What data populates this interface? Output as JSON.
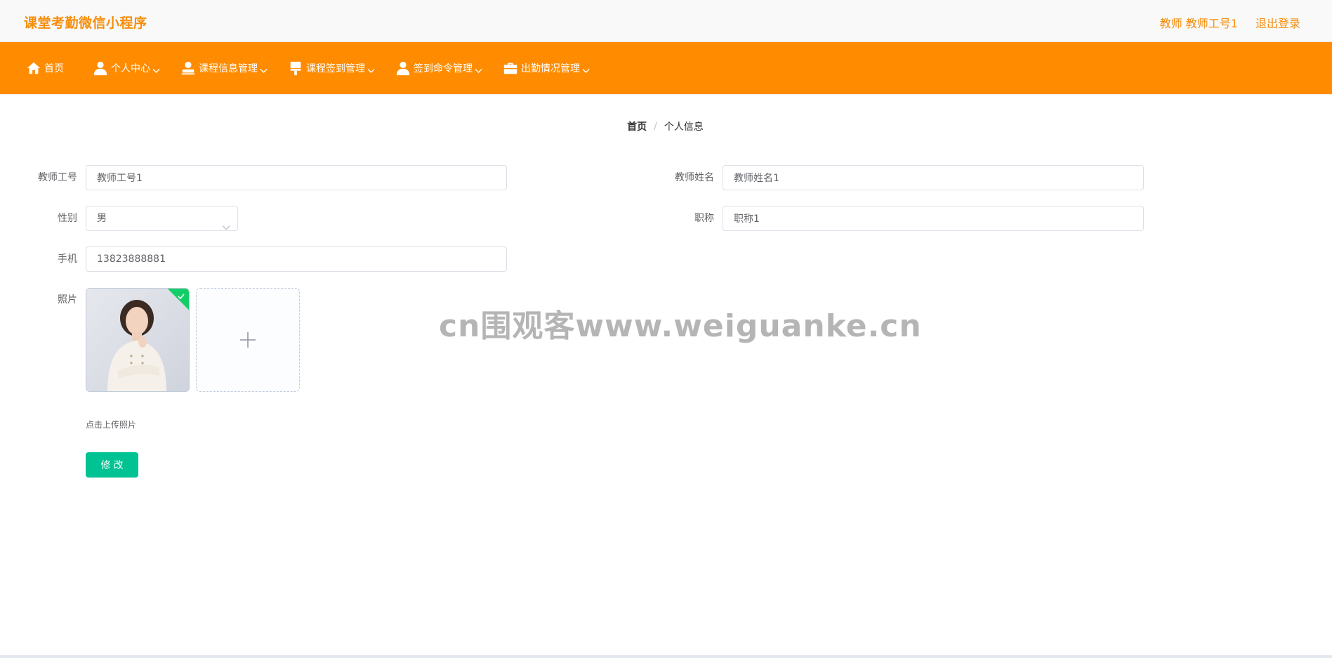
{
  "header": {
    "title": "课堂考勤微信小程序",
    "user_label": "教师 教师工号1",
    "logout_label": "退出登录"
  },
  "nav": {
    "items": [
      {
        "label": "首页",
        "icon": "home-icon",
        "has_dropdown": false
      },
      {
        "label": "个人中心",
        "icon": "user-icon",
        "has_dropdown": true
      },
      {
        "label": "课程信息管理",
        "icon": "stamp-icon",
        "has_dropdown": true
      },
      {
        "label": "课程签到管理",
        "icon": "brush-icon",
        "has_dropdown": true
      },
      {
        "label": "签到命令管理",
        "icon": "user-icon",
        "has_dropdown": true
      },
      {
        "label": "出勤情况管理",
        "icon": "briefcase-icon",
        "has_dropdown": true
      }
    ]
  },
  "breadcrumb": {
    "home": "首页",
    "separator": "/",
    "current": "个人信息"
  },
  "form": {
    "teacher_id": {
      "label": "教师工号",
      "value": "教师工号1"
    },
    "teacher_name": {
      "label": "教师姓名",
      "value": "教师姓名1"
    },
    "gender": {
      "label": "性别",
      "value": "男"
    },
    "title": {
      "label": "职称",
      "value": "职称1"
    },
    "phone": {
      "label": "手机",
      "value": "13823888881"
    },
    "photo": {
      "label": "照片",
      "tip": "点击上传照片"
    },
    "submit_label": "修改"
  },
  "watermark": "cn围观客www.weiguanke.cn",
  "colors": {
    "brand": "#f58d0b",
    "nav_bg": "#ff8c00",
    "submit_bg": "#00c292",
    "upload_success": "#13ce66"
  }
}
